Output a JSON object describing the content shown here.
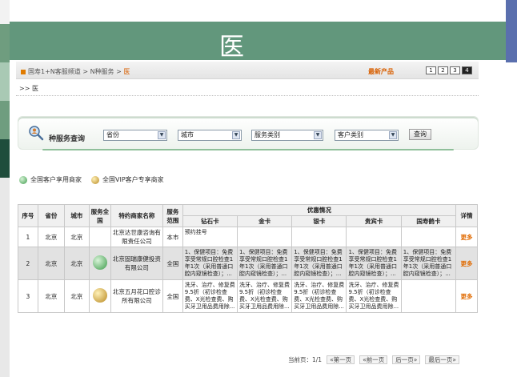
{
  "slide": {
    "title": "医"
  },
  "breadcrumb": {
    "items": [
      "国寿1+N客服频道",
      "N种服务",
      "医"
    ],
    "separator": ">"
  },
  "new_products_label": "最新产品",
  "top_pager": {
    "pages": [
      "1",
      "2",
      "3",
      "4"
    ],
    "active": 4
  },
  "subheading": ">> 医",
  "search": {
    "label": "种服务查询",
    "province": "省份",
    "city": "城市",
    "service_type": "服务类别",
    "customer_type": "客户类别",
    "query_button": "查询"
  },
  "legend": [
    {
      "label": "全国客户享用商家",
      "icon": "green-badge-icon"
    },
    {
      "label": "全国VIP客户专享商家",
      "icon": "gold-badge-icon"
    }
  ],
  "table": {
    "headers": {
      "no": "序号",
      "province": "省份",
      "city": "城市",
      "national": "服务全国",
      "merchant": "特约商家名称",
      "scope": "服务范围",
      "offers": "优惠情况",
      "diamond": "钻石卡",
      "gold": "金卡",
      "silver": "银卡",
      "guest": "贵宾卡",
      "crane": "国寿鹤卡",
      "detail": "详情"
    },
    "rows": [
      {
        "no": "1",
        "province": "北京",
        "city": "北京",
        "badge": "",
        "merchant": "北京达世康咨询有限责任公司",
        "scope": "本市",
        "diamond": "预约挂号",
        "gold": "",
        "silver": "",
        "guest": "",
        "crane": "",
        "more": "更多"
      },
      {
        "no": "2",
        "province": "北京",
        "city": "北京",
        "badge": "green",
        "merchant": "北京固瑞康健投资有限公司",
        "scope": "全国",
        "diamond": "1、保健项目：免费享受常规口腔检查1年1次（采用普通口腔内窥镜检查）；...",
        "gold": "1、保健项目：免费享受常规口腔检查1年1次（采用普通口腔内窥镜检查）；...",
        "silver": "1、保健项目：免费享受常规口腔检查1年1次（采用普通口腔内窥镜检查）；...",
        "guest": "1、保健项目：免费享受常规口腔检查1年1次（采用普通口腔内窥镜检查）；...",
        "crane": "1、保健项目：免费享受常规口腔检查1年1次（采用普通口腔内窥镜检查）；...",
        "more": "更多"
      },
      {
        "no": "3",
        "province": "北京",
        "city": "北京",
        "badge": "gold",
        "merchant": "北京五月花口腔诊所有限公司",
        "scope": "全国",
        "diamond": "洗牙、治疗、修复费9.5折（初诊检查费、X光检查费、购买牙卫用品费用除...",
        "gold": "洗牙、治疗、修复费9.5折（初诊检查费、X光检查费、购买牙卫用品费用除...",
        "silver": "洗牙、治疗、修复费9.5折（初诊检查费、X光检查费、购买牙卫用品费用除...",
        "guest": "洗牙、治疗、修复费9.5折（初诊检查费、X光检查费、购买牙卫用品费用除...",
        "crane": "",
        "more": "更多"
      }
    ]
  },
  "bottom_pager": {
    "current": "当前页：1/1",
    "first": "«第一页",
    "prev": "«前一页",
    "next": "后一页»",
    "last": "最后一页»"
  }
}
